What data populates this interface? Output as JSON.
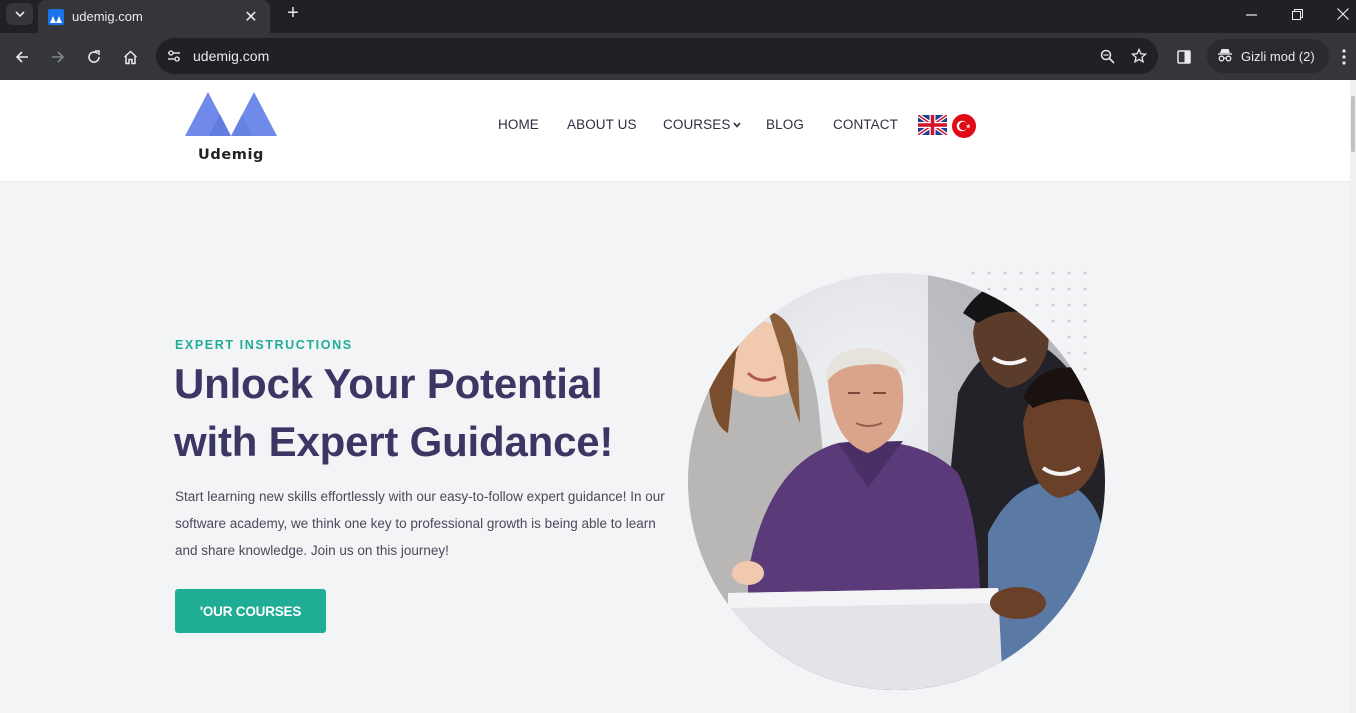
{
  "browser": {
    "tab_title": "udemig.com",
    "url": "udemig.com",
    "incognito_label": "Gizli mod (2)",
    "icons": [
      "tab-search-icon",
      "close-icon",
      "plus-icon",
      "minimize-icon",
      "restore-icon",
      "window-close-icon",
      "back-icon",
      "forward-icon",
      "reload-icon",
      "home-icon",
      "site-info-icon",
      "zoom-icon",
      "star-icon",
      "side-panel-icon",
      "incognito-icon",
      "menu-icon"
    ]
  },
  "site": {
    "logo_text": "Udemig",
    "brand_color": "#6f8ae8",
    "nav": {
      "home": "HOME",
      "about": "ABOUT US",
      "courses": "COURSES",
      "blog": "BLOG",
      "contact": "CONTACT"
    },
    "languages": [
      "english-flag",
      "turkish-flag"
    ]
  },
  "hero": {
    "eyebrow": "EXPERT INSTRUCTIONS",
    "headline_line1": "Unlock Your Potential",
    "headline_line2": "with Expert Guidance!",
    "description": "Start learning new skills effortlessly with our easy-to-follow expert guidance! In our software academy, we think one key to professional growth is being able to learn and share knowledge. Join us on this journey!",
    "cta_label": "'OUR COURSES",
    "accent_color": "#20ad96",
    "heading_color": "#3b3663"
  }
}
